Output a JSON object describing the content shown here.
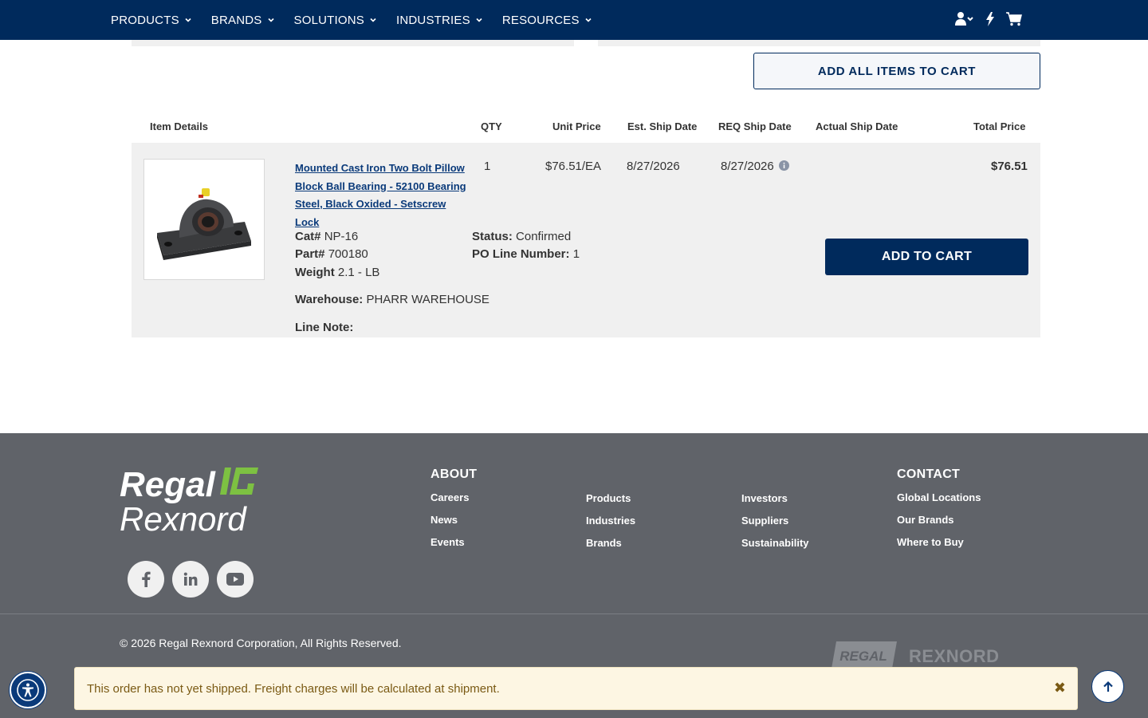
{
  "nav": {
    "menu": [
      {
        "label": "PRODUCTS"
      },
      {
        "label": "BRANDS"
      },
      {
        "label": "SOLUTIONS"
      },
      {
        "label": "INDUSTRIES"
      },
      {
        "label": "RESOURCES"
      }
    ],
    "icons": [
      "user-account-icon",
      "quick-order-bolt-icon",
      "cart-icon"
    ]
  },
  "actions": {
    "add_all_label": "ADD ALL ITEMS TO CART"
  },
  "table": {
    "headers": {
      "item_details": "Item Details",
      "qty": "QTY",
      "unit_price": "Unit Price",
      "est_ship": "Est. Ship Date",
      "req_ship": "REQ Ship Date",
      "actual_ship": "Actual Ship Date",
      "total": "Total Price"
    },
    "row": {
      "product_name": "Mounted Cast Iron Two Bolt Pillow Block Ball Bearing - 52100 Bearing Steel, Black Oxided - Setscrew Lock",
      "qty": "1",
      "unit_price": "$76.51/EA",
      "est_ship": "8/27/2026",
      "req_ship": "8/27/2026",
      "actual_ship": "",
      "total": "$76.51",
      "cat_label": "Cat#",
      "cat_value": "NP-16",
      "part_label": "Part#",
      "part_value": "700180",
      "weight_label": "Weight",
      "weight_value": "2.1 - LB",
      "status_label": "Status:",
      "status_value": "Confirmed",
      "po_label": "PO Line Number:",
      "po_value": "1",
      "warehouse_label": "Warehouse:",
      "warehouse_value": "PHARR WAREHOUSE",
      "line_note_label": "Line Note:",
      "add_to_cart_label": "ADD TO CART"
    }
  },
  "footer": {
    "logo_line1": "Regal",
    "logo_line2": "Rexnord",
    "about_heading": "ABOUT",
    "contact_heading": "CONTACT",
    "about_links": [
      "Careers",
      "News",
      "Events"
    ],
    "col2_links": [
      "Products",
      "Industries",
      "Brands"
    ],
    "col3_links": [
      "Investors",
      "Suppliers",
      "Sustainability"
    ],
    "contact_links": [
      "Global Locations",
      "Our Brands",
      "Where to Buy"
    ],
    "social": [
      "facebook-icon",
      "linkedin-icon",
      "youtube-icon"
    ],
    "copyright": "© 2026 Regal Rexnord Corporation, All Rights Reserved.",
    "brand_regal": "REGAL",
    "brand_rexnord": "REXNORD"
  },
  "notice": {
    "text": "This order has not yet shipped. Freight charges will be calculated at shipment.",
    "close": "✖"
  },
  "colors": {
    "navy": "#002a5c",
    "footer_bg": "#606369",
    "row_bg": "#f0f0f0",
    "notice_bg": "#fdf6e3"
  }
}
